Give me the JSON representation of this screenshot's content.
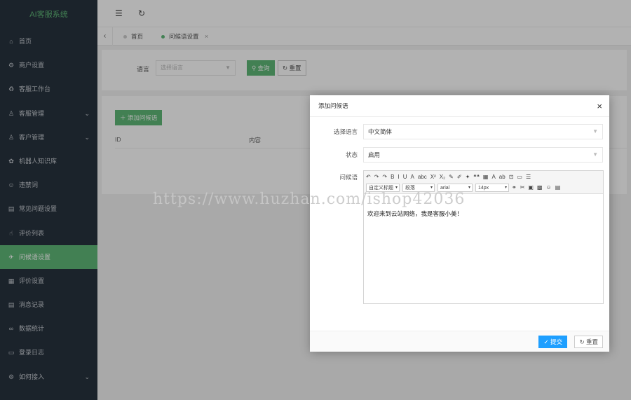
{
  "sidebar": {
    "brand": "AI客服系统",
    "items": [
      {
        "icon": "⌂",
        "label": "首页",
        "arrow": ""
      },
      {
        "icon": "⚙",
        "label": "商户设置",
        "arrow": ""
      },
      {
        "icon": "♻",
        "label": "客服工作台",
        "arrow": ""
      },
      {
        "icon": "♙",
        "label": "客服管理",
        "arrow": "⌄"
      },
      {
        "icon": "♙",
        "label": "客户管理",
        "arrow": "⌄"
      },
      {
        "icon": "✿",
        "label": "机器人知识库",
        "arrow": ""
      },
      {
        "icon": "☺",
        "label": "违禁词",
        "arrow": ""
      },
      {
        "icon": "▤",
        "label": "常见问题设置",
        "arrow": ""
      },
      {
        "icon": "☝",
        "label": "评价列表",
        "arrow": ""
      },
      {
        "icon": "✈",
        "label": "问候语设置",
        "arrow": "",
        "active": true
      },
      {
        "icon": "▦",
        "label": "评价设置",
        "arrow": ""
      },
      {
        "icon": "▤",
        "label": "消息记录",
        "arrow": ""
      },
      {
        "icon": "∞",
        "label": "数据统计",
        "arrow": ""
      },
      {
        "icon": "▭",
        "label": "登录日志",
        "arrow": ""
      },
      {
        "icon": "⚙",
        "label": "如何接入",
        "arrow": "⌄"
      }
    ]
  },
  "topbar": {
    "menu_icon": "☰",
    "refresh_icon": "↻"
  },
  "tabs": {
    "prev": "‹",
    "items": [
      {
        "label": "首页",
        "close": ""
      },
      {
        "label": "问候语设置",
        "close": "×"
      }
    ]
  },
  "search": {
    "language_label": "语言",
    "language_placeholder": "选择语言",
    "query_button": "查询",
    "reset_button": "重置"
  },
  "table": {
    "add_button": "＋ 添加问候语",
    "columns": [
      "ID",
      "内容"
    ]
  },
  "modal": {
    "title": "添加问候语",
    "close": "×",
    "language_label": "选择语言",
    "language_value": "中文简体",
    "status_label": "状态",
    "status_value": "启用",
    "greeting_label": "问候语",
    "editor": {
      "toolbar_row1": [
        "↶",
        "↷",
        "↷",
        "B",
        "I",
        "U",
        "A",
        "abc",
        "X²",
        "X₂",
        "✎",
        "✐",
        "✦",
        "❝❝",
        "▦",
        "A",
        "ab",
        "⊡",
        "▭",
        "☰"
      ],
      "paragraph_format": "自定义标题",
      "paragraph": "段落",
      "font_family": "arial",
      "font_size": "14px",
      "toolbar_row2_icons": [
        "⚭",
        "✂",
        "▣",
        "▩",
        "☺",
        "▤"
      ],
      "content": "欢迎来到云站网络，我是客服小美！"
    },
    "submit_button": "提交",
    "reset_button": "重置"
  },
  "watermark": "https://www.huzhan.com/ishop42036"
}
